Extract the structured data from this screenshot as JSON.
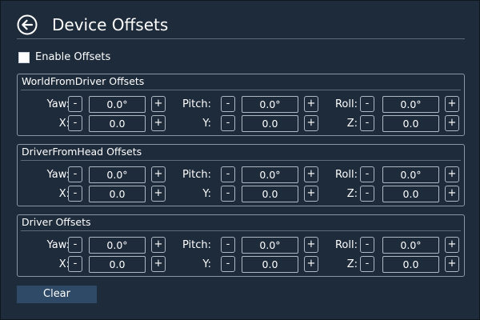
{
  "header": {
    "title": "Device Offsets",
    "back_icon": "back-arrow-circle-icon"
  },
  "enable_offsets": {
    "label": "Enable Offsets",
    "checked": false
  },
  "button_labels": {
    "minus": "-",
    "plus": "+"
  },
  "groups": [
    {
      "title": "WorldFromDriver Offsets",
      "rows": [
        [
          {
            "label": "Yaw:",
            "value": "0.0°"
          },
          {
            "label": "Pitch:",
            "value": "0.0°"
          },
          {
            "label": "Roll:",
            "value": "0.0°"
          }
        ],
        [
          {
            "label": "X:",
            "value": "0.0"
          },
          {
            "label": "Y:",
            "value": "0.0"
          },
          {
            "label": "Z:",
            "value": "0.0"
          }
        ]
      ]
    },
    {
      "title": "DriverFromHead Offsets",
      "rows": [
        [
          {
            "label": "Yaw:",
            "value": "0.0°"
          },
          {
            "label": "Pitch:",
            "value": "0.0°"
          },
          {
            "label": "Roll:",
            "value": "0.0°"
          }
        ],
        [
          {
            "label": "X:",
            "value": "0.0"
          },
          {
            "label": "Y:",
            "value": "0.0"
          },
          {
            "label": "Z:",
            "value": "0.0"
          }
        ]
      ]
    },
    {
      "title": "Driver Offsets",
      "rows": [
        [
          {
            "label": "Yaw:",
            "value": "0.0°"
          },
          {
            "label": "Pitch:",
            "value": "0.0°"
          },
          {
            "label": "Roll:",
            "value": "0.0°"
          }
        ],
        [
          {
            "label": "X:",
            "value": "0.0"
          },
          {
            "label": "Y:",
            "value": "0.0"
          },
          {
            "label": "Z:",
            "value": "0.0"
          }
        ]
      ]
    }
  ],
  "clear_button": {
    "label": "Clear"
  },
  "colors": {
    "background": "#1e2b3b",
    "border": "#8896a6",
    "button_fill": "#2e4a66",
    "text": "#ffffff"
  }
}
